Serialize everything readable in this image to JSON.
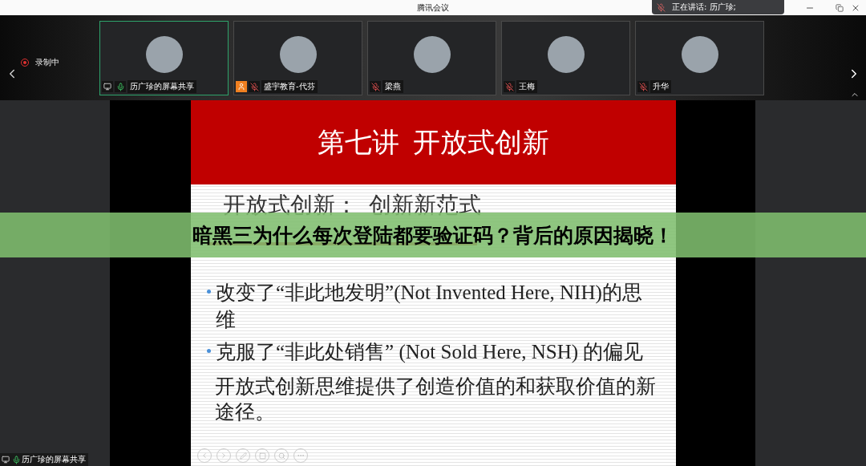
{
  "window": {
    "title": "腾讯会议"
  },
  "speaking_toast": {
    "text": "正在讲话: 历广珍;"
  },
  "recording": {
    "label": "录制中"
  },
  "participants": [
    {
      "name": "历广珍的屏幕共享",
      "speaking": true,
      "muted": false,
      "sharing": true,
      "cohost": false
    },
    {
      "name": "盛宇教育-代芬",
      "speaking": false,
      "muted": true,
      "sharing": false,
      "cohost": true
    },
    {
      "name": "梁燕",
      "speaking": false,
      "muted": true,
      "sharing": false,
      "cohost": false
    },
    {
      "name": "王梅",
      "speaking": false,
      "muted": true,
      "sharing": false,
      "cohost": false
    },
    {
      "name": "升华",
      "speaking": false,
      "muted": true,
      "sharing": false,
      "cohost": false
    }
  ],
  "slide": {
    "title": "第七讲  开放式创新",
    "subtitle": "开放式创新：  创新新范式",
    "bullets": [
      "改变了“非此地发明”(Not Invented Here, NIH)的思维",
      "克服了“非此处销售” (Not Sold Here, NSH) 的偏见"
    ],
    "paragraph": "开放式创新思维提供了创造价值的和获取价值的新途径。"
  },
  "banner": {
    "text": "暗黑三为什么每次登陆都要验证码？背后的原因揭晓！"
  },
  "share_label": {
    "text": "历广珍的屏幕共享",
    "muted": false
  }
}
